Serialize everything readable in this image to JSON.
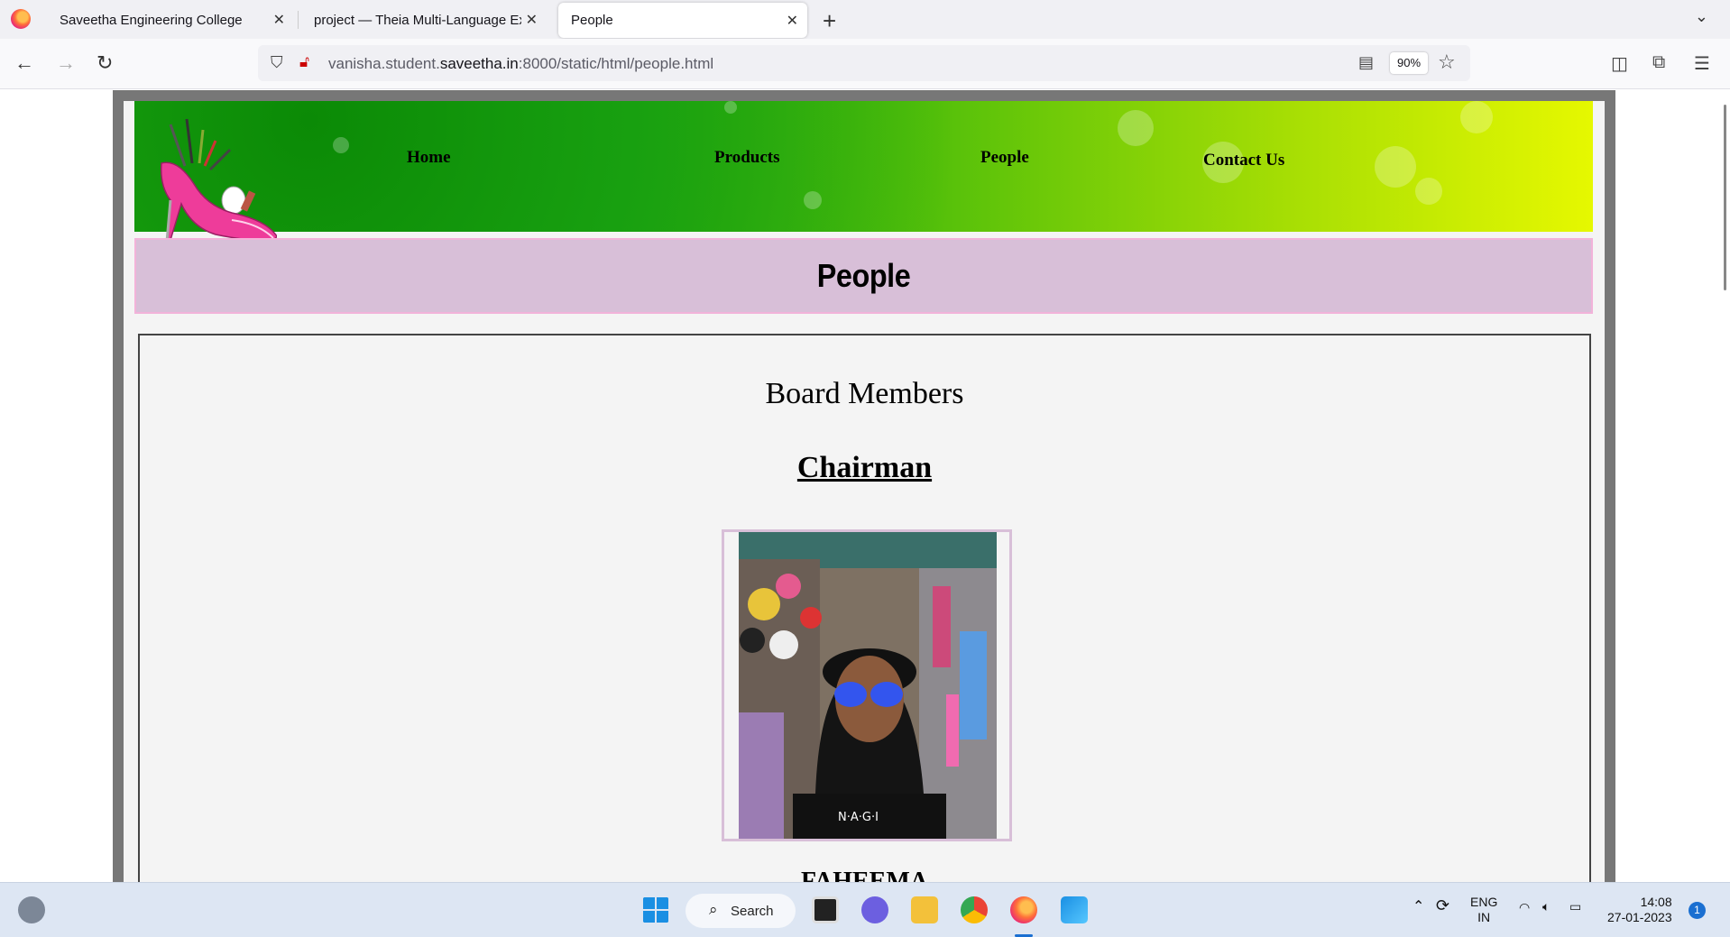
{
  "browser": {
    "tabs": [
      {
        "title": "Saveetha Engineering College",
        "active": false
      },
      {
        "title": "project — Theia Multi-Language Ex",
        "active": false
      },
      {
        "title": "People",
        "active": true
      }
    ],
    "url_prefix": "vanisha.student.",
    "url_host": "saveetha.in",
    "url_suffix": ":8000/static/html/people.html",
    "zoom": "90%"
  },
  "site": {
    "nav": [
      "Home",
      "Products",
      "People",
      "Contact Us"
    ],
    "page_title": "People",
    "section_title": "Board Members",
    "role": "Chairman",
    "name": "FAHEEMA"
  },
  "taskbar": {
    "search_label": "Search",
    "lang_line1": "ENG",
    "lang_line2": "IN",
    "time": "14:08",
    "date": "27-01-2023",
    "notifications": "1"
  }
}
